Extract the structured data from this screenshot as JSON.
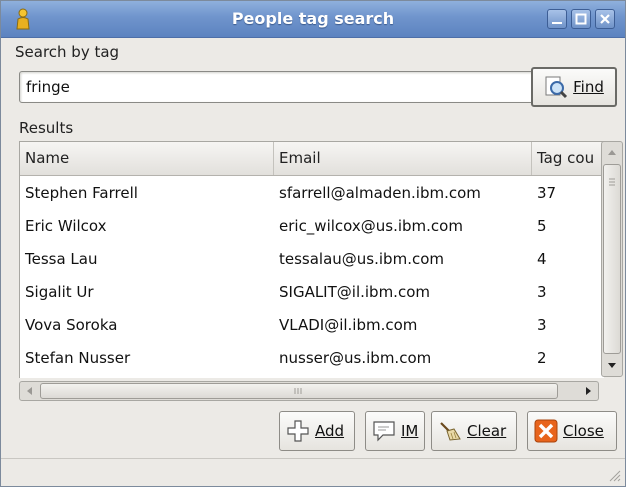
{
  "window": {
    "title": "People tag search"
  },
  "search": {
    "label": "Search by tag",
    "value": "fringe",
    "find_label": "Find"
  },
  "results": {
    "label": "Results",
    "columns": [
      "Name",
      "Email",
      "Tag cou"
    ],
    "rows": [
      {
        "name": "Stephen Farrell",
        "email": "sfarrell@almaden.ibm.com",
        "count": "37"
      },
      {
        "name": "Eric Wilcox",
        "email": "eric_wilcox@us.ibm.com",
        "count": "5"
      },
      {
        "name": "Tessa Lau",
        "email": "tessalau@us.ibm.com",
        "count": "4"
      },
      {
        "name": "Sigalit Ur",
        "email": "SIGALIT@il.ibm.com",
        "count": "3"
      },
      {
        "name": "Vova Soroka",
        "email": "VLADI@il.ibm.com",
        "count": "3"
      },
      {
        "name": "Stefan Nusser",
        "email": "nusser@us.ibm.com",
        "count": "2"
      }
    ]
  },
  "actions": {
    "add": "Add",
    "im": "IM",
    "clear": "Clear",
    "close": "Close"
  },
  "colors": {
    "titlebar": "#6f94cc",
    "close_icon": "#e8641c",
    "selection": "#ffffff"
  }
}
